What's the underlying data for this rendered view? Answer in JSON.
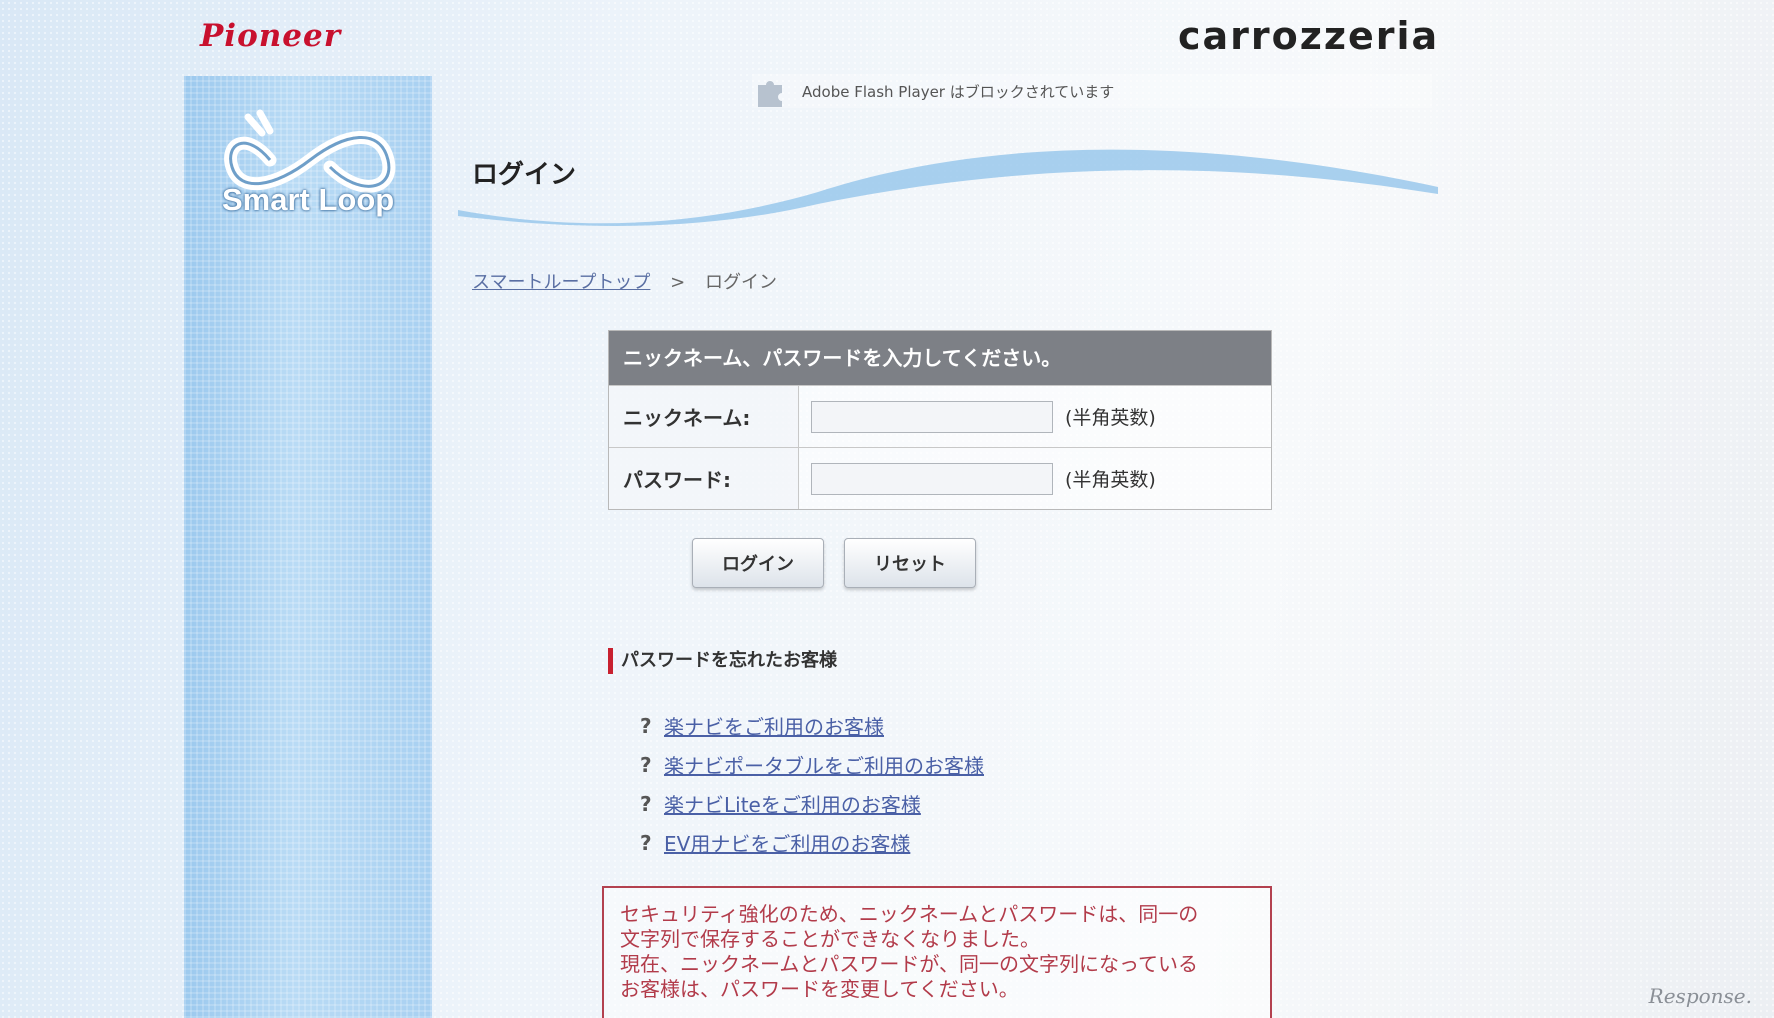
{
  "header": {
    "brand_left": "Pioneer",
    "brand_right": "carrozzeria"
  },
  "sidebar": {
    "logo_text": "Smart Loop"
  },
  "flash_notice": "Adobe Flash Player はブロックされています",
  "page": {
    "title": "ログイン"
  },
  "breadcrumb": {
    "home": "スマートループトップ",
    "separator": ">",
    "current": "ログイン"
  },
  "login_form": {
    "header": "ニックネーム、パスワードを入力してください。",
    "nickname_label": "ニックネーム:",
    "nickname_value": "",
    "nickname_hint": "(半角英数)",
    "password_label": "パスワード:",
    "password_value": "",
    "password_hint": "(半角英数)",
    "login_button": "ログイン",
    "reset_button": "リセット"
  },
  "forgot": {
    "heading": "パスワードを忘れたお客様",
    "links": [
      "楽ナビをご利用のお客様",
      "楽ナビポータブルをご利用のお客様",
      "楽ナビLiteをご利用のお客様",
      "EV用ナビをご利用のお客様"
    ]
  },
  "notice": {
    "line1": "セキュリティ強化のため、ニックネームとパスワードは、同一の",
    "line2": "文字列で保存することができなくなりました。",
    "line3": "現在、ニックネームとパスワードが、同一の文字列になっている",
    "line4": "お客様は、パスワードを変更してください。"
  },
  "watermark": "Response.",
  "colors": {
    "brand_red": "#c8102e",
    "form_header_bg": "#7d8086",
    "link": "#4a60a6",
    "notice_red": "#b23b4a",
    "sidebar_blue": "#a8d0f1"
  }
}
